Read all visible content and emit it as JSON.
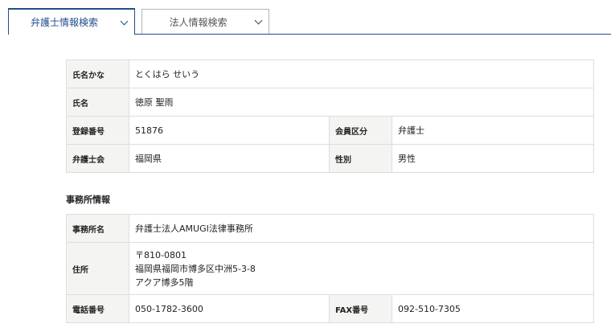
{
  "tabs": [
    {
      "label": "弁護士情報検索",
      "active": true
    },
    {
      "label": "法人情報検索",
      "active": false
    }
  ],
  "profile": {
    "kana_label": "氏名かな",
    "kana_value": "とくはら せいう",
    "name_label": "氏名",
    "name_value": "徳原 聖雨",
    "reg_label": "登録番号",
    "reg_value": "51876",
    "member_label": "会員区分",
    "member_value": "弁護士",
    "bar_label": "弁護士会",
    "bar_value": "福岡県",
    "gender_label": "性別",
    "gender_value": "男性"
  },
  "office": {
    "section_title": "事務所情報",
    "name_label": "事務所名",
    "name_value": "弁護士法人AMUGI法律事務所",
    "address_label": "住所",
    "address_lines": [
      "〒810-0801",
      "福岡県福岡市博多区中洲5-3-8",
      "アクア博多5階"
    ],
    "phone_label": "電話番号",
    "phone_value": "050-1782-3600",
    "fax_label": "FAX番号",
    "fax_value": "092-510-7305"
  },
  "colors": {
    "accent": "#1f4e8c",
    "header_cell_bg": "#f4f4f2",
    "border": "#dddddd"
  }
}
